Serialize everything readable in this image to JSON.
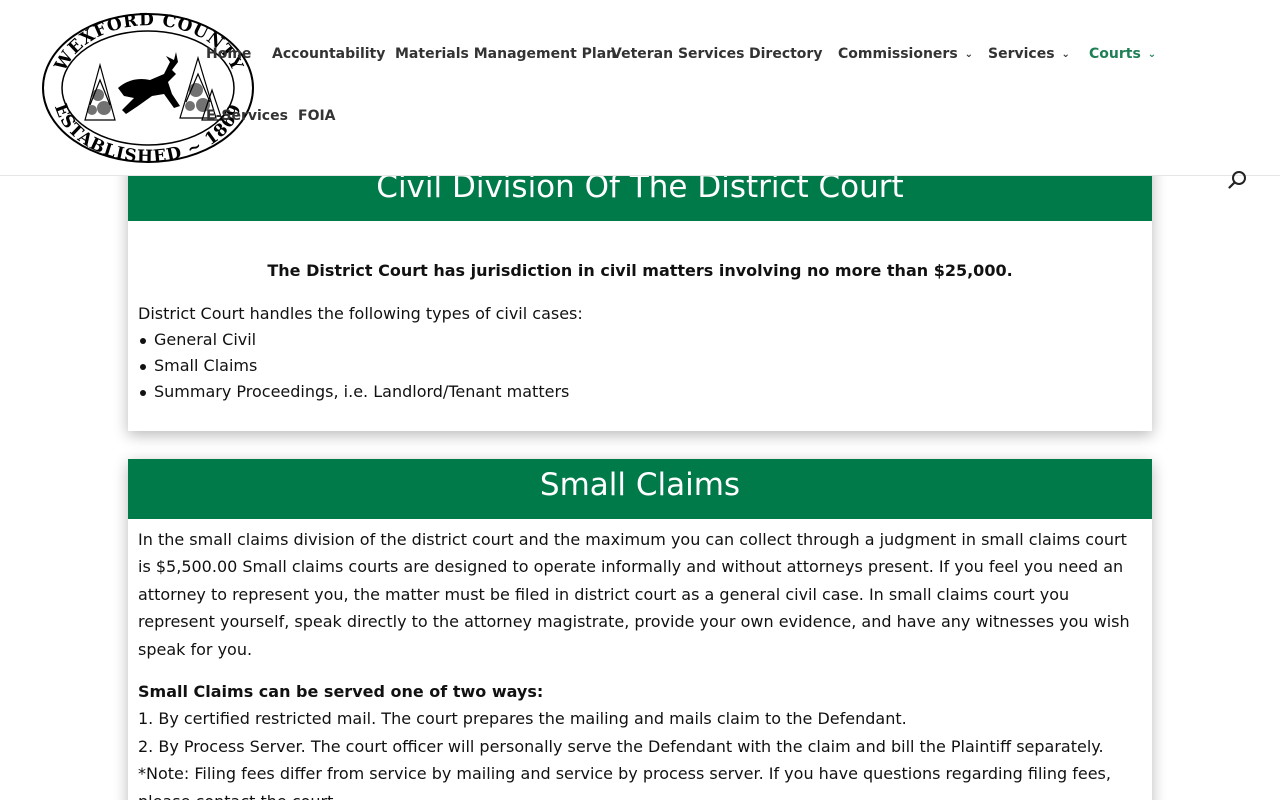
{
  "logo": {
    "top_text": "WEXFORD COUNTY",
    "bottom_text": "ESTABLISHED ~ 1869"
  },
  "nav": {
    "items": [
      {
        "label": "Home"
      },
      {
        "label": "Accountability"
      },
      {
        "label": "Materials Management Plan"
      },
      {
        "label": "Veteran Services"
      },
      {
        "label": "Directory"
      },
      {
        "label": "Commissioners",
        "dropdown": true
      },
      {
        "label": "Services",
        "dropdown": true
      },
      {
        "label": "Courts",
        "dropdown": true,
        "active": true
      },
      {
        "label": "E-Services"
      },
      {
        "label": "FOIA"
      }
    ],
    "chevron_glyph": "⌄",
    "active_color": "#1e7f55"
  },
  "search": {
    "icon": "search-icon"
  },
  "civil": {
    "title": "Civil Division Of The District Court",
    "jurisdiction": "The District Court has jurisdiction in civil matters involving no more than $25,000.",
    "intro": "District Court handles the following types of civil cases:",
    "cases": [
      "General Civil",
      "Small Claims",
      "Summary Proceedings, i.e. Landlord/Tenant matters"
    ]
  },
  "small_claims": {
    "title": "Small Claims",
    "para1": "In the small claims division of the district court and the maximum you can collect through a judgment in small claims court is $5,500.00 Small claims courts are designed to operate informally and without attorneys present. If you feel you need an attorney to represent you, the matter must be filed in district court as a general civil case. In small claims court you represent yourself, speak directly to the attorney magistrate, provide your own evidence, and have any witnesses you wish speak for you.",
    "served_heading": "Small Claims can be served one of two ways:",
    "way1": "1. By certified restricted mail. The court prepares the mailing and mails claim to the Defendant.",
    "way2": "2. By Process Server. The court officer will personally serve the Defendant with the claim and bill the Plaintiff separately.",
    "note": "*Note: Filing fees differ from service by mailing and service by process server. If you have questions regarding filing fees, please contact the court."
  },
  "colors": {
    "banner": "#017a4a",
    "nav_text": "#333333"
  }
}
